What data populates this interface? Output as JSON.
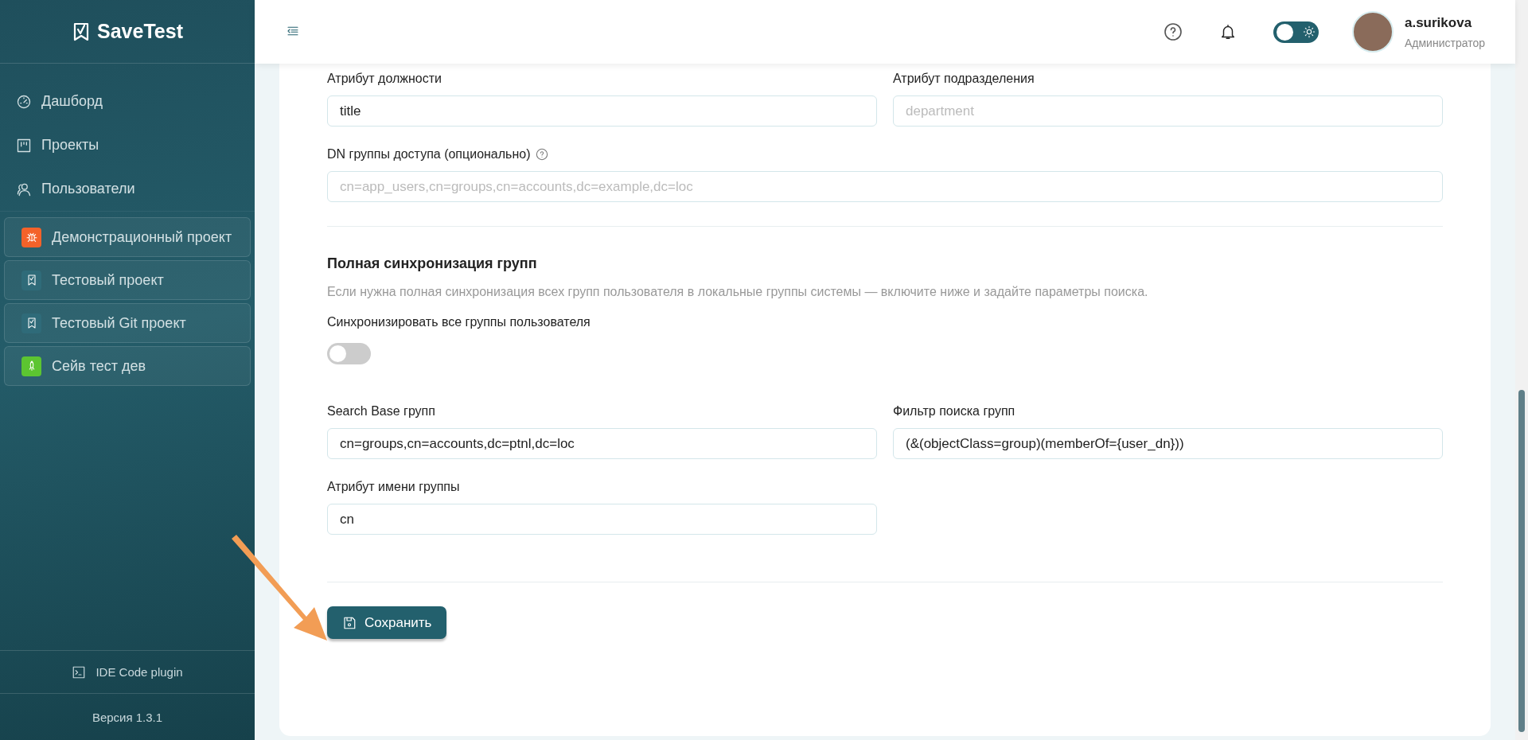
{
  "sidebar": {
    "logo": "SaveTest",
    "nav": [
      {
        "label": "Дашборд",
        "kind": "dashboard"
      },
      {
        "label": "Проекты",
        "kind": "projects"
      },
      {
        "label": "Пользователи",
        "kind": "users"
      }
    ],
    "projects": [
      {
        "name": "Демонстрационный проект",
        "kind": "bug",
        "color": "#f4622a"
      },
      {
        "name": "Тестовый проект",
        "kind": "check",
        "color": "#2f6b79"
      },
      {
        "name": "Тестовый Git проект",
        "kind": "check",
        "color": "#2f6b79"
      },
      {
        "name": "Сейв тест дев",
        "kind": "rocket",
        "color": "#5cc531"
      }
    ],
    "plugin": "IDE Code plugin",
    "version": "Версия 1.3.1"
  },
  "header": {
    "dark_mode": false,
    "user": {
      "name": "a.surikova",
      "role": "Администратор"
    }
  },
  "form": {
    "fields_top": [
      {
        "label": "Атрибут должности",
        "value": "title"
      },
      {
        "label": "Атрибут подразделения",
        "placeholder": "department"
      }
    ],
    "access_group": {
      "label": "DN группы доступа (опционально)",
      "placeholder": "cn=app_users,cn=groups,cn=accounts,dc=example,dc=loc"
    },
    "group_sync": {
      "title": "Полная синхронизация групп",
      "description": "Если нужна полная синхронизация всех групп пользователя в локальные группы системы — включите ниже и задайте параметры поиска.",
      "toggle": {
        "label": "Синхронизировать все группы пользователя",
        "on": false
      },
      "fields": [
        {
          "label": "Search Base групп",
          "value": "cn=groups,cn=accounts,dc=ptnl,dc=loc"
        },
        {
          "label": "Фильтр поиска групп",
          "value": "(&(objectClass=group)(memberOf={user_dn}))"
        },
        {
          "label": "Атрибут имени группы",
          "value": "cn"
        }
      ]
    },
    "save_button": "Сохранить"
  }
}
